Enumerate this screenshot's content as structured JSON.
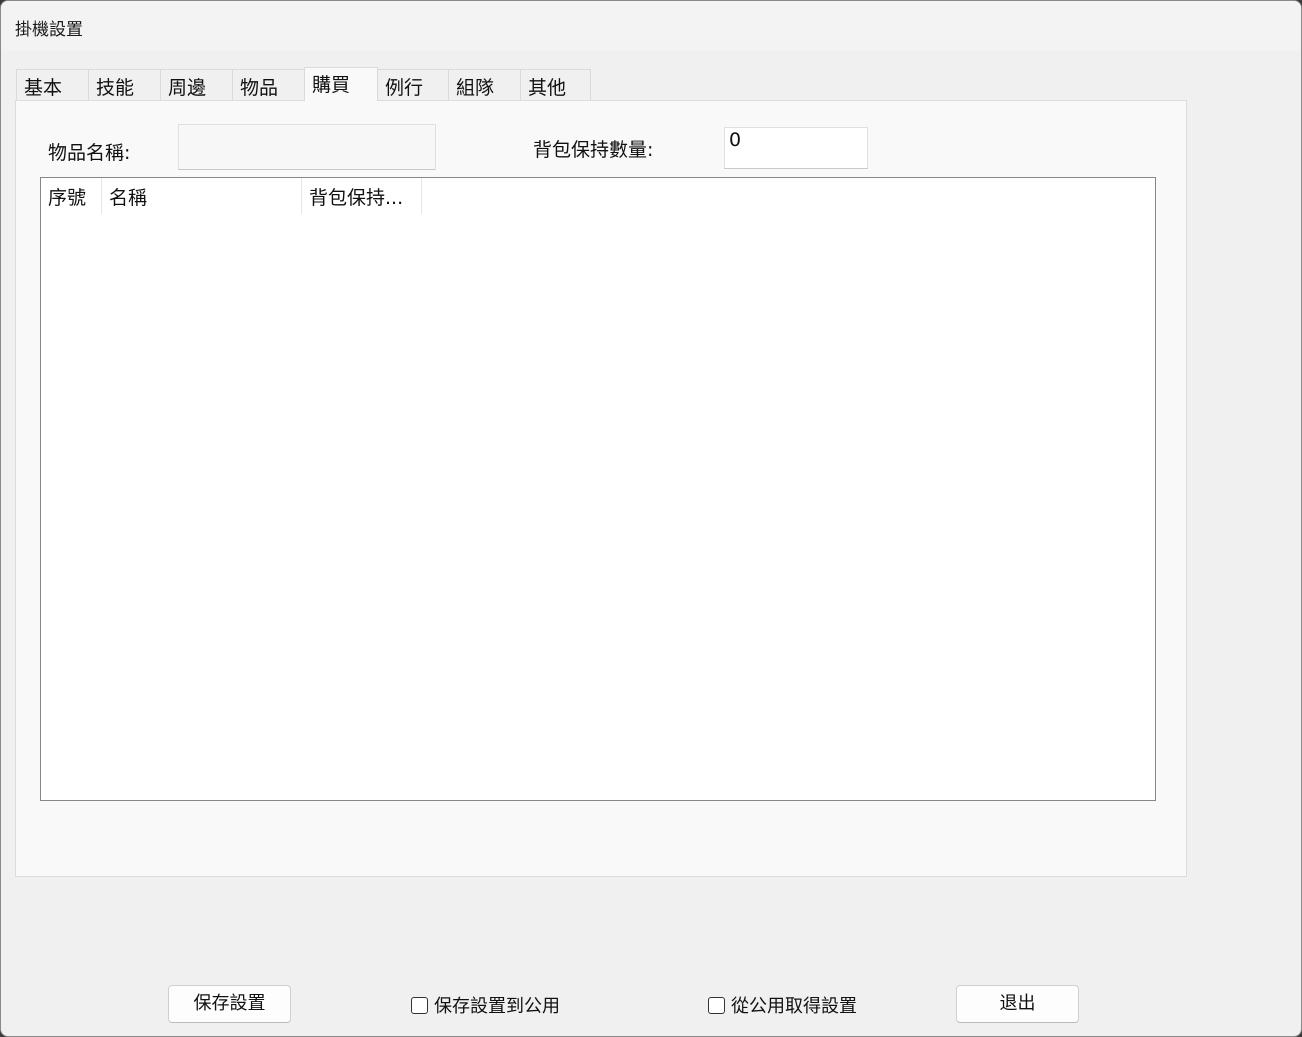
{
  "window": {
    "title": "掛機設置"
  },
  "tabs": [
    {
      "label": "基本"
    },
    {
      "label": "技能"
    },
    {
      "label": "周邊"
    },
    {
      "label": "物品"
    },
    {
      "label": "購買",
      "active": true
    },
    {
      "label": "例行"
    },
    {
      "label": "組隊"
    },
    {
      "label": "其他"
    }
  ],
  "form": {
    "item_name_label": "物品名稱:",
    "item_name_value": "",
    "keep_qty_label": "背包保持數量:",
    "keep_qty_value": "0"
  },
  "list": {
    "columns": [
      "序號",
      "名稱",
      "背包保持..."
    ],
    "rows": []
  },
  "footer": {
    "save_button": "保存設置",
    "save_public_checkbox": "保存設置到公用",
    "save_public_checked": false,
    "load_public_checkbox": "從公用取得設置",
    "load_public_checked": false,
    "exit_button": "退出"
  }
}
